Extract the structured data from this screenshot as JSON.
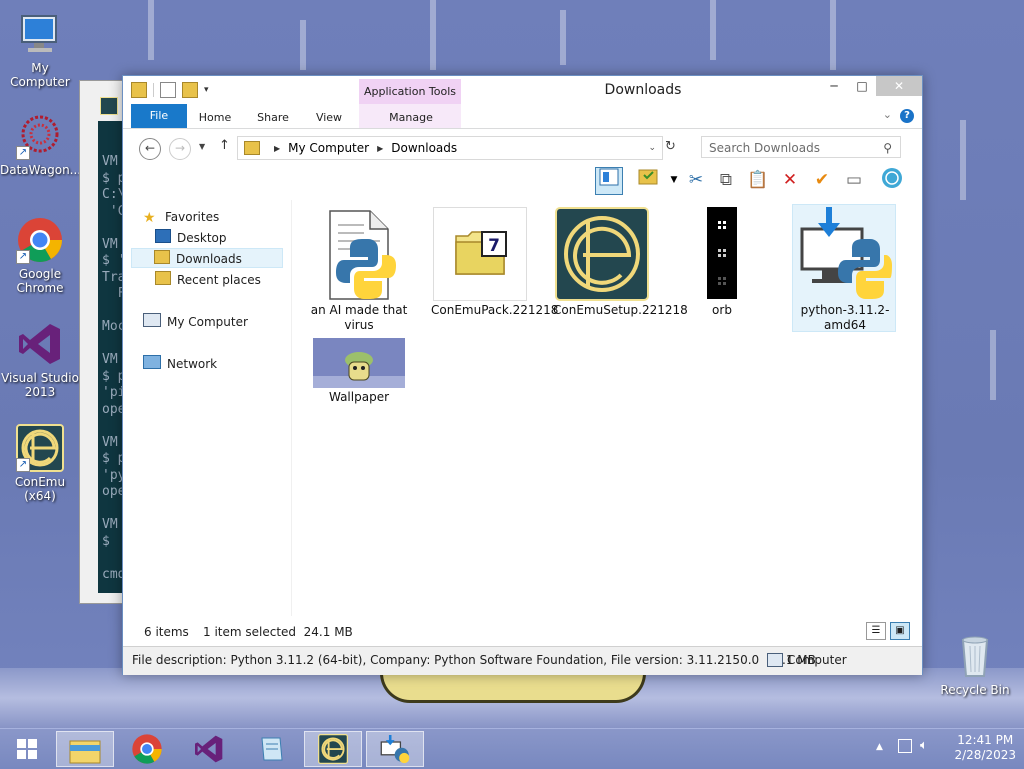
{
  "desktop": {
    "icons": [
      {
        "label": "My Computer"
      },
      {
        "label": "DataWagon..."
      },
      {
        "label": "Google Chrome"
      },
      {
        "label": "Visual Studio 2013"
      },
      {
        "label": "ConEmu (x64)"
      },
      {
        "label": "Recycle Bin"
      }
    ]
  },
  "console": {
    "lines": [
      "",
      "",
      "VM",
      "$ p",
      "C:\\",
      " 'C",
      "",
      "VM",
      "$ '",
      "Tra",
      "  F",
      "",
      "Moc",
      "",
      "VM",
      "$ p",
      "'pi",
      "ope",
      "",
      "VM",
      "$ p",
      "'py",
      "ope",
      "",
      "VM",
      "$ ",
      "",
      "cmd"
    ]
  },
  "window": {
    "title": "Downloads",
    "context_group": "Application Tools",
    "tabs": {
      "file": "File",
      "home": "Home",
      "share": "Share",
      "view": "View",
      "manage": "Manage"
    },
    "address": {
      "segments": [
        "My Computer",
        "Downloads"
      ]
    },
    "search": {
      "placeholder": "Search Downloads"
    },
    "nav": {
      "favorites": "Favorites",
      "desktop": "Desktop",
      "downloads": "Downloads",
      "recent": "Recent places",
      "computer": "My Computer",
      "network": "Network"
    },
    "items": [
      {
        "label": "an AI made that virus",
        "icon": "python-script-icon"
      },
      {
        "label": "ConEmuPack.221218",
        "icon": "7zip-archive-icon"
      },
      {
        "label": "ConEmuSetup.221218",
        "icon": "conemu-icon"
      },
      {
        "label": "orb",
        "icon": "orb-icon"
      },
      {
        "label": "python-3.11.2-amd64",
        "icon": "python-installer-icon",
        "selected": true
      },
      {
        "label": "Wallpaper",
        "icon": "wallpaper-thumbnail"
      }
    ],
    "status": {
      "count": "6 items",
      "selection": "1 item selected  24.1 MB"
    },
    "details": {
      "description": "File description: Python 3.11.2 (64-bit), Company: Python Software Foundation, File version: 3.11.2150.0  24.1 MB",
      "location": "Computer"
    }
  },
  "taskbar": {
    "time": "12:41 PM",
    "date": "2/28/2023"
  },
  "colors": {
    "accent": "#1979ca",
    "context": "#f0d2f4",
    "selection": "#e5f3fb"
  }
}
